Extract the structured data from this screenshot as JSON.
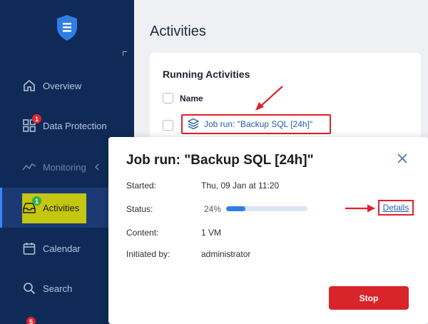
{
  "sidebar": {
    "items": [
      {
        "label": "Overview",
        "icon": "home-icon"
      },
      {
        "label": "Data Protection",
        "icon": "grid-icon",
        "badge": "1"
      },
      {
        "label": "Monitoring",
        "icon": "pulse-icon"
      },
      {
        "label": "Activities",
        "icon": "inbox-icon",
        "badge": "1"
      },
      {
        "label": "Calendar",
        "icon": "calendar-icon"
      },
      {
        "label": "Search",
        "icon": "search-icon"
      }
    ],
    "bottom_badge": "5"
  },
  "page": {
    "title": "Activities"
  },
  "running": {
    "title": "Running Activities",
    "column_name": "Name",
    "job_link": "Job run: \"Backup SQL [24h]\""
  },
  "dialog": {
    "title": "Job run: \"Backup SQL [24h]\"",
    "started_label": "Started:",
    "started_value": "Thu, 09 Jan at 11:20",
    "status_label": "Status:",
    "status_percent": "24%",
    "progress_value": 0.24,
    "details_link": "Details",
    "content_label": "Content:",
    "content_value": "1 VM",
    "initiated_label": "Initiated by:",
    "initiated_value": "administrator",
    "stop_label": "Stop"
  },
  "colors": {
    "sidebar_bg": "#0f2a57",
    "accent": "#2f7ee5",
    "danger": "#d8242a",
    "annotation": "#e2202a"
  }
}
